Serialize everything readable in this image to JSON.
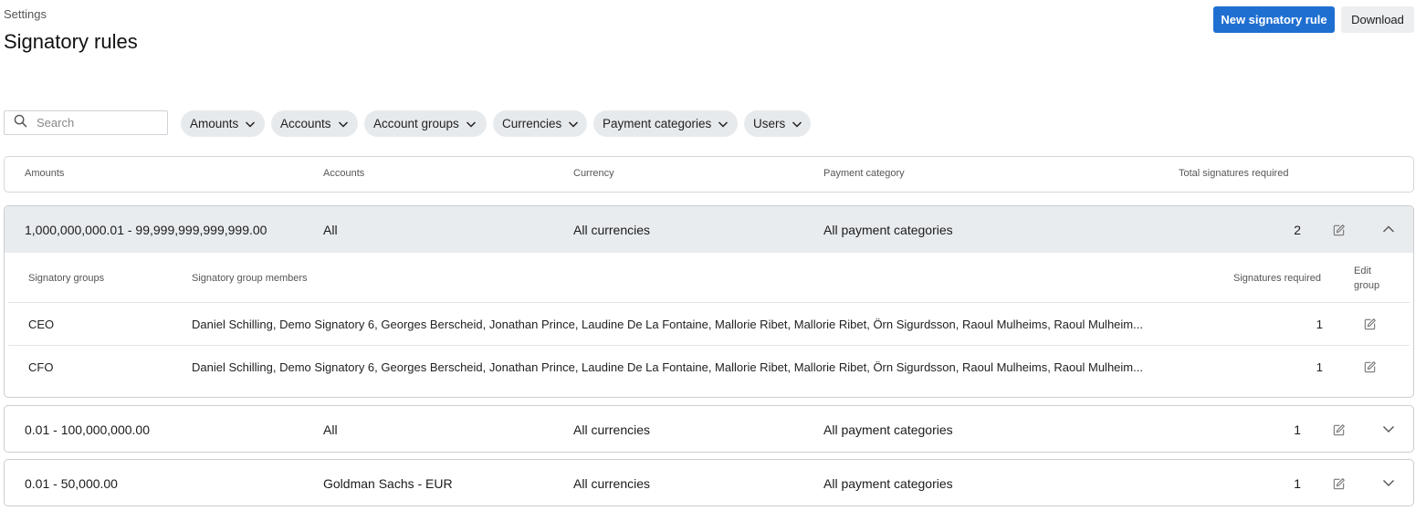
{
  "header": {
    "breadcrumb": "Settings",
    "title": "Signatory rules",
    "new_rule_label": "New signatory rule",
    "download_label": "Download",
    "accent_color": "#1f6fd1"
  },
  "filters": {
    "search_placeholder": "Search",
    "items": [
      {
        "label": "Amounts"
      },
      {
        "label": "Accounts"
      },
      {
        "label": "Account groups"
      },
      {
        "label": "Currencies"
      },
      {
        "label": "Payment categories"
      },
      {
        "label": "Users"
      }
    ]
  },
  "table": {
    "columns": {
      "amounts": "Amounts",
      "accounts": "Accounts",
      "currency": "Currency",
      "payment_category": "Payment category",
      "total_signatures": "Total signatures required"
    },
    "rules": [
      {
        "amounts": "1,000,000,000.01 - 99,999,999,999,999.00",
        "accounts": "All",
        "currency": "All currencies",
        "payment_category": "All payment categories",
        "total_signatures": "2",
        "expanded": true,
        "groups_table": {
          "col_groups": "Signatory groups",
          "col_members": "Signatory group members",
          "col_required": "Signatures required",
          "col_edit_line1": "Edit",
          "col_edit_line2": "group",
          "rows": [
            {
              "group": "CEO",
              "members": "Daniel Schilling, Demo Signatory 6, Georges Berscheid, Jonathan Prince, Laudine De La Fontaine, Mallorie Ribet, Mallorie Ribet, Örn Sigurdsson, Raoul Mulheims, Raoul Mulheim...",
              "required": "1"
            },
            {
              "group": "CFO",
              "members": "Daniel Schilling, Demo Signatory 6, Georges Berscheid, Jonathan Prince, Laudine De La Fontaine, Mallorie Ribet, Mallorie Ribet, Örn Sigurdsson, Raoul Mulheims, Raoul Mulheim...",
              "required": "1"
            }
          ]
        }
      },
      {
        "amounts": "0.01 - 100,000,000.00",
        "accounts": "All",
        "currency": "All currencies",
        "payment_category": "All payment categories",
        "total_signatures": "1",
        "expanded": false
      },
      {
        "amounts": "0.01 - 50,000.00",
        "accounts": "Goldman Sachs - EUR",
        "currency": "All currencies",
        "payment_category": "All payment categories",
        "total_signatures": "1",
        "expanded": false
      }
    ]
  }
}
